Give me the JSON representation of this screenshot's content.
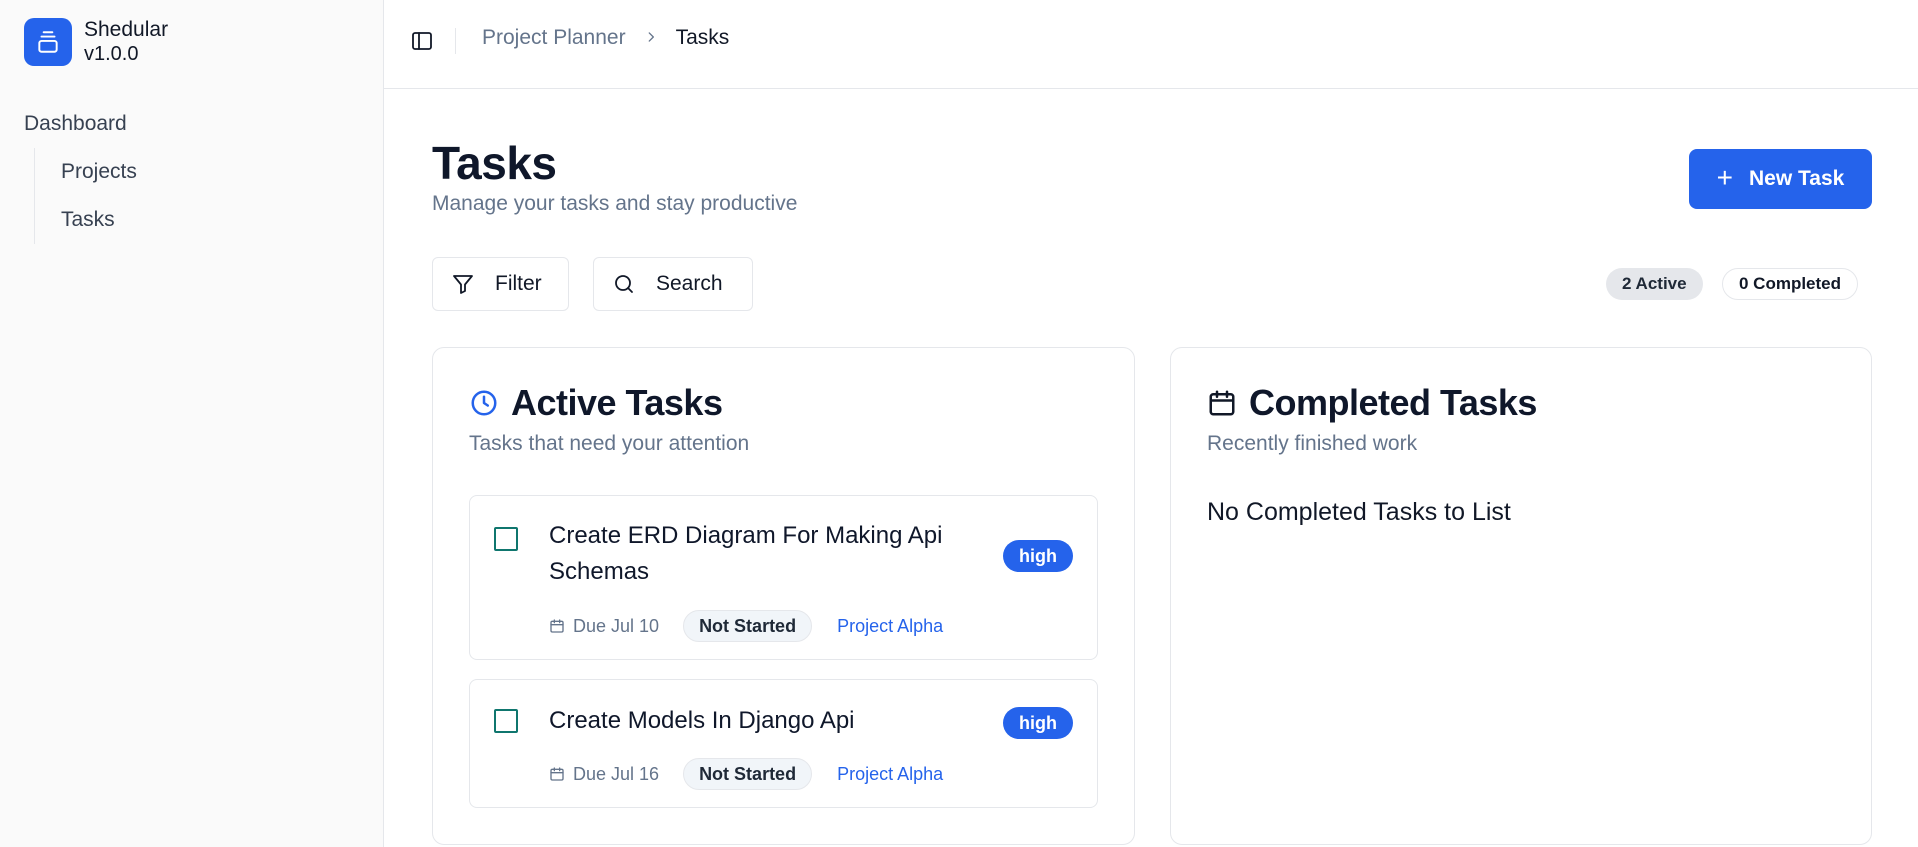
{
  "brand": {
    "name": "Shedular",
    "version": "v1.0.0"
  },
  "sidebar": {
    "group_label": "Dashboard",
    "items": [
      {
        "label": "Projects"
      },
      {
        "label": "Tasks"
      }
    ]
  },
  "breadcrumb": {
    "parent": "Project Planner",
    "current": "Tasks"
  },
  "page": {
    "title": "Tasks",
    "subtitle": "Manage your tasks and stay productive",
    "new_task_label": "New Task"
  },
  "toolbar": {
    "filter_label": "Filter",
    "search_label": "Search",
    "active_count": "2 Active",
    "completed_count": "0 Completed"
  },
  "active_tasks": {
    "title": "Active Tasks",
    "subtitle": "Tasks that need your attention",
    "tasks": [
      {
        "title": "Create ERD Diagram For Making Api Schemas",
        "priority": "high",
        "due": "Due Jul 10",
        "status": "Not Started",
        "project": "Project Alpha"
      },
      {
        "title": "Create Models In Django Api",
        "priority": "high",
        "due": "Due Jul 16",
        "status": "Not Started",
        "project": "Project Alpha"
      }
    ]
  },
  "completed_tasks": {
    "title": "Completed Tasks",
    "subtitle": "Recently finished work",
    "empty_message": "No Completed Tasks to List"
  },
  "colors": {
    "accent": "#2563eb",
    "muted": "#64748b",
    "checkbox": "#0f766e"
  }
}
